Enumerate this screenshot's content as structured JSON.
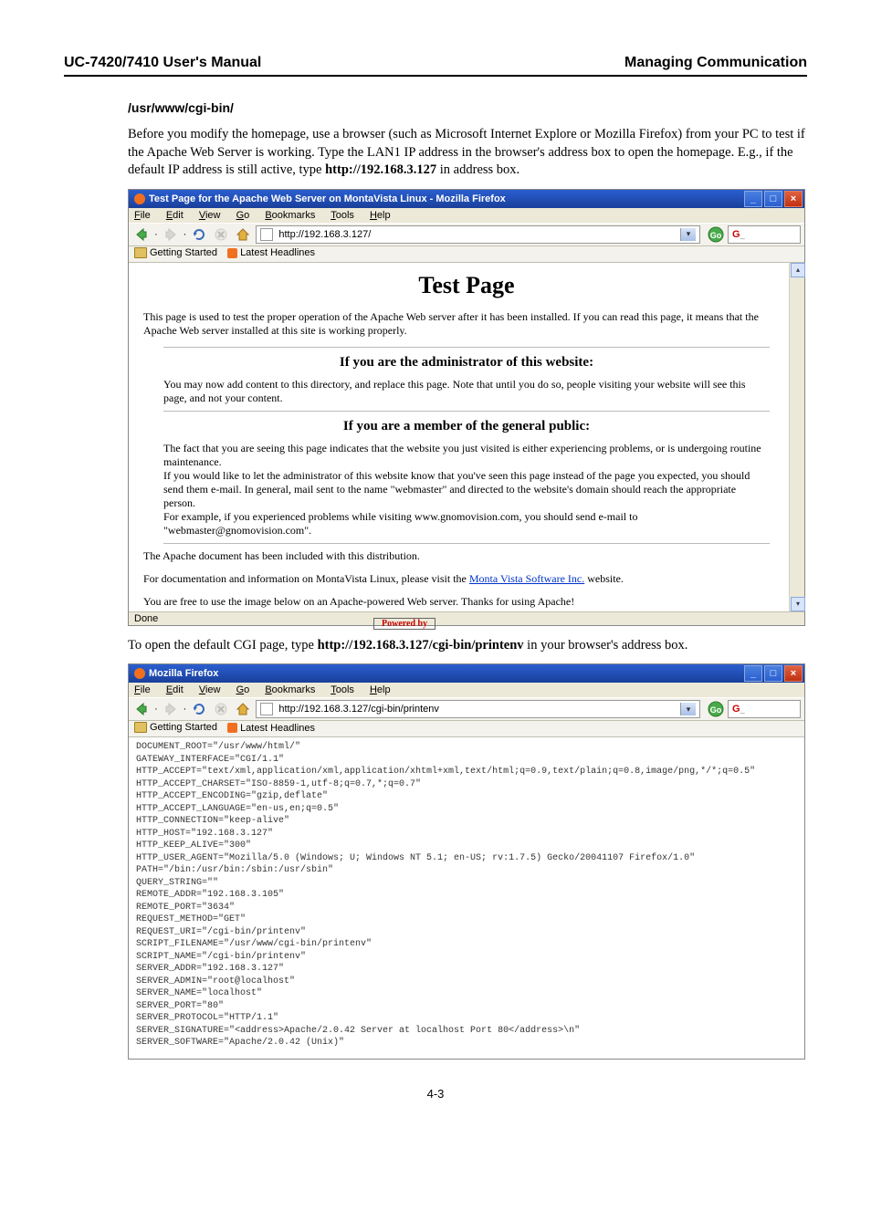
{
  "doc": {
    "header_left": "UC-7420/7410 User's Manual",
    "header_right": "Managing Communication",
    "section_title": "/usr/www/cgi-bin/",
    "intro_p1": "Before you modify the homepage, use a browser (such as Microsoft Internet Explore or Mozilla Firefox) from your PC to test if the Apache Web Server is working. Type the LAN1 IP address in the browser's address box to open the homepage. E.g., if the default IP address is still active, type ",
    "intro_url": "http://192.168.3.127",
    "intro_p1_tail": " in address box.",
    "mid_p": "To open the default CGI page, type ",
    "mid_url": "http://192.168.3.127/cgi-bin/printenv",
    "mid_p_tail": " in your browser's address box.",
    "page_num": "4-3"
  },
  "ff": {
    "title1": "Test Page for the Apache Web Server on MontaVista Linux - Mozilla Firefox",
    "title2": "Mozilla Firefox",
    "menu": {
      "file": "File",
      "edit": "Edit",
      "view": "View",
      "go": "Go",
      "bookmarks": "Bookmarks",
      "tools": "Tools",
      "help": "Help"
    },
    "url1": "http://192.168.3.127/",
    "url2": "http://192.168.3.127/cgi-bin/printenv",
    "go": "Go",
    "bm1": "Getting Started",
    "bm2": "Latest Headlines",
    "status": "Done"
  },
  "testpage": {
    "h1": "Test Page",
    "p1": "This page is used to test the proper operation of the Apache Web server after it has been installed. If you can read this page, it means that the Apache Web server installed at this site is working properly.",
    "h2a": "If you are the administrator of this website:",
    "p2": "You may now add content to this directory, and replace this page. Note that until you do so, people visiting your website will see this page, and not your content.",
    "h2b": "If you are a member of the general public:",
    "p3": "The fact that you are seeing this page indicates that the website you just visited is either experiencing problems, or is undergoing routine maintenance.",
    "p4": "If you would like to let the administrator of this website know that you've seen this page instead of the page you expected, you should send them e-mail. In general, mail sent to the name \"webmaster\" and directed to the website's domain should reach the appropriate person.",
    "p5_pre": "For example, if you experienced problems while visiting www.gnomovision.com, you should send e-mail to \"webmaster@gnomovision.com\".",
    "p6": "The Apache document has been included with this distribution.",
    "p7_pre": "For documentation and information on MontaVista Linux, please visit the ",
    "p7_link": "Monta Vista Software Inc.",
    "p7_post": " website.",
    "p8": "You are free to use the image below on an Apache-powered Web server. Thanks for using Apache!",
    "powered": "Powered by"
  },
  "env": [
    "DOCUMENT_ROOT=\"/usr/www/html/\"",
    "GATEWAY_INTERFACE=\"CGI/1.1\"",
    "HTTP_ACCEPT=\"text/xml,application/xml,application/xhtml+xml,text/html;q=0.9,text/plain;q=0.8,image/png,*/*;q=0.5\"",
    "HTTP_ACCEPT_CHARSET=\"ISO-8859-1,utf-8;q=0.7,*;q=0.7\"",
    "HTTP_ACCEPT_ENCODING=\"gzip,deflate\"",
    "HTTP_ACCEPT_LANGUAGE=\"en-us,en;q=0.5\"",
    "HTTP_CONNECTION=\"keep-alive\"",
    "HTTP_HOST=\"192.168.3.127\"",
    "HTTP_KEEP_ALIVE=\"300\"",
    "HTTP_USER_AGENT=\"Mozilla/5.0 (Windows; U; Windows NT 5.1; en-US; rv:1.7.5) Gecko/20041107 Firefox/1.0\"",
    "PATH=\"/bin:/usr/bin:/sbin:/usr/sbin\"",
    "QUERY_STRING=\"\"",
    "REMOTE_ADDR=\"192.168.3.105\"",
    "REMOTE_PORT=\"3634\"",
    "REQUEST_METHOD=\"GET\"",
    "REQUEST_URI=\"/cgi-bin/printenv\"",
    "SCRIPT_FILENAME=\"/usr/www/cgi-bin/printenv\"",
    "SCRIPT_NAME=\"/cgi-bin/printenv\"",
    "SERVER_ADDR=\"192.168.3.127\"",
    "SERVER_ADMIN=\"root@localhost\"",
    "SERVER_NAME=\"localhost\"",
    "SERVER_PORT=\"80\"",
    "SERVER_PROTOCOL=\"HTTP/1.1\"",
    "SERVER_SIGNATURE=\"<address>Apache/2.0.42 Server at localhost Port 80</address>\\n\"",
    "SERVER_SOFTWARE=\"Apache/2.0.42 (Unix)\""
  ]
}
